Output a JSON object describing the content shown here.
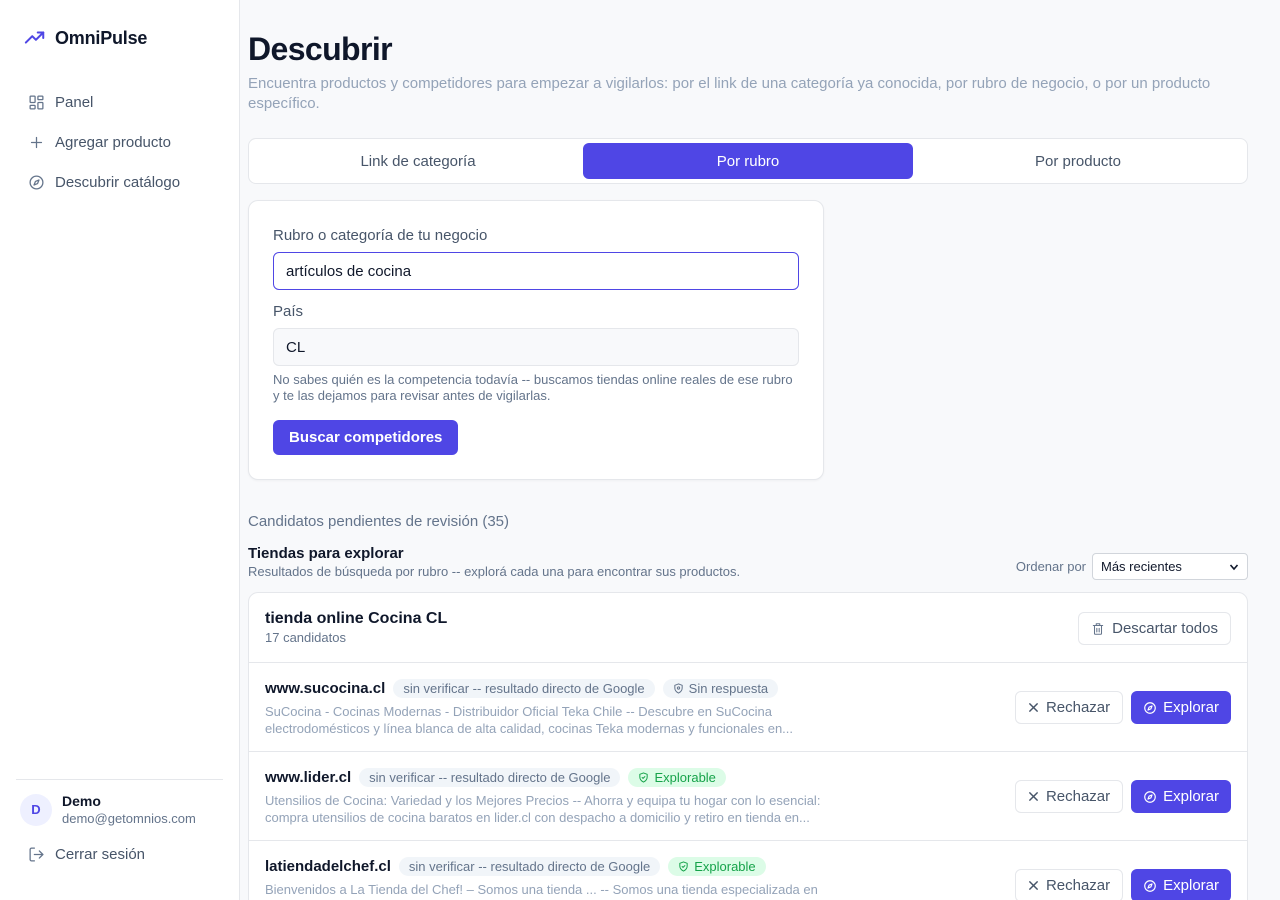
{
  "app": {
    "name": "OmniPulse",
    "logo_icon": "trending-up-icon",
    "accent": "#4f46e5"
  },
  "sidebar": {
    "items": [
      {
        "label": "Panel",
        "icon": "grid-icon"
      },
      {
        "label": "Agregar producto",
        "icon": "plus-icon"
      },
      {
        "label": "Descubrir catálogo",
        "icon": "compass-icon"
      }
    ],
    "user": {
      "initial": "D",
      "name": "Demo",
      "email": "demo@getomnios.com"
    },
    "logout_label": "Cerrar sesión"
  },
  "page": {
    "title": "Descubrir",
    "subtitle": "Encuentra productos y competidores para empezar a vigilarlos: por el link de una categoría ya conocida, por rubro de negocio, o por un producto específico."
  },
  "tabs": [
    {
      "label": "Link de categoría",
      "active": false
    },
    {
      "label": "Por rubro",
      "active": true
    },
    {
      "label": "Por producto",
      "active": false
    }
  ],
  "form": {
    "rubro_label": "Rubro o categoría de tu negocio",
    "rubro_value": "artículos de cocina",
    "pais_label": "País",
    "pais_value": "CL",
    "help": "No sabes quién es la competencia todavía -- buscamos tiendas online reales de ese rubro y te las dejamos para revisar antes de vigilarlas.",
    "submit_label": "Buscar competidores"
  },
  "pending_label": "Candidatos pendientes de revisión (35)",
  "section": {
    "title": "Tiendas para explorar",
    "subtitle": "Resultados de búsqueda por rubro -- explorá cada una para encontrar sus productos.",
    "sort_label": "Ordenar por",
    "sort_value": "Más recientes"
  },
  "group": {
    "title": "tienda online Cocina CL",
    "count": "17 candidatos",
    "discard_label": "Descartar todos"
  },
  "candidates": [
    {
      "domain": "www.sucocina.cl",
      "source": "sin verificar -- resultado directo de Google",
      "status": "Sin respuesta",
      "status_type": "none",
      "description": "SuCocina - Cocinas Modernas - Distribuidor Oficial Teka Chile -- Descubre en SuCocina electrodomésticos y línea blanca de alta calidad, cocinas Teka modernas y funcionales en...",
      "reject_label": "Rechazar",
      "explore_label": "Explorar"
    },
    {
      "domain": "www.lider.cl",
      "source": "sin verificar -- resultado directo de Google",
      "status": "Explorable",
      "status_type": "ok",
      "description": "Utensilios de Cocina: Variedad y los Mejores Precios -- Ahorra y equipa tu hogar con lo esencial: compra utensilios de cocina baratos en lider.cl con despacho a domicilio y retiro en tienda en...",
      "reject_label": "Rechazar",
      "explore_label": "Explorar"
    },
    {
      "domain": "latiendadelchef.cl",
      "source": "sin verificar -- resultado directo de Google",
      "status": "Explorable",
      "status_type": "ok",
      "description": "Bienvenidos a La Tienda del Chef! – Somos una tienda ... -- Somos una tienda especializada en",
      "reject_label": "Rechazar",
      "explore_label": "Explorar"
    }
  ]
}
